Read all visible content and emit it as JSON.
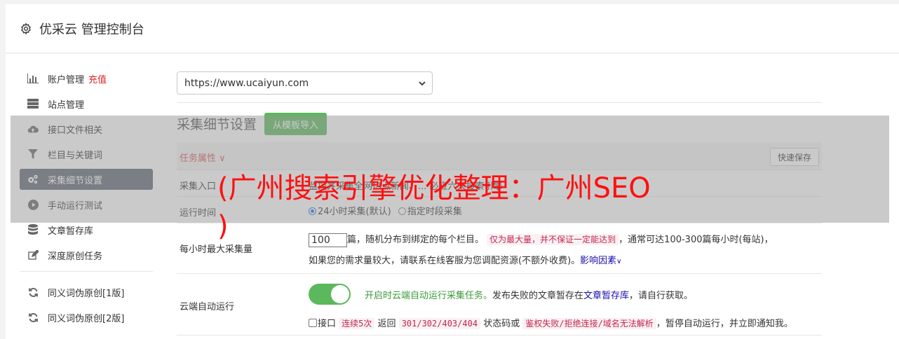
{
  "header": {
    "icon": "gear-icon",
    "title": "优采云 管理控制台"
  },
  "sidebar": {
    "items": [
      {
        "icon": "bar-chart-icon",
        "label": "账户管理",
        "extra": "充值"
      },
      {
        "icon": "server-icon",
        "label": "站点管理"
      },
      {
        "icon": "cloud-upload-icon",
        "label": "接口文件相关"
      },
      {
        "icon": "filter-icon",
        "label": "栏目与关键词"
      },
      {
        "icon": "cogs-icon",
        "label": "采集细节设置"
      },
      {
        "icon": "play-circle-icon",
        "label": "手动运行测试"
      },
      {
        "icon": "database-icon",
        "label": "文章暂存库"
      },
      {
        "icon": "edit-icon",
        "label": "深度原创任务"
      },
      {
        "icon": "refresh-icon",
        "label": "同义词伪原创[1版]"
      },
      {
        "icon": "refresh-icon",
        "label": "同义词伪原创[2版]"
      }
    ]
  },
  "site_select": {
    "value": "https://www.ucaiyun.com"
  },
  "section": {
    "title": "采集细节设置",
    "import_button": "从模板导入"
  },
  "table": {
    "task_attr": "任务属性",
    "quick_save": "快速保存",
    "entry": {
      "label": "采集入口",
      "value": "监控并采集全网热点新闻、... 必应六大搜索引擎"
    },
    "runtime": {
      "label": "运行时间",
      "opt1": "24小时采集(默认)",
      "opt2": "指定时段采集"
    },
    "per_hour": {
      "label": "每小时最大采集量",
      "input_value": "100",
      "t1": "篇，随机分布到绑定的每个栏目。",
      "code": "仅为最大量，并不保证一定能达到",
      "t2": "，通常可达100-300篇每小时(每站)，",
      "t3": "如果您的需求量较大，请联系在线客服为您调配资源(不额外收费)。",
      "link": "影响因素"
    },
    "cloud": {
      "label": "云端自动运行",
      "desc1": "开启时云端自动运行采集任务。",
      "desc2": "发布失败的文章暂存在",
      "desc_link": "文章暂存库",
      "desc3": "，请自行获取。",
      "cb_label": "接口",
      "code1": "连续5次",
      "t_return": "返回",
      "code2": "301/302/403/404",
      "t_status": "状态码或",
      "code3": "鉴权失败/拒绝连接/域名无法解析",
      "t_end": "，暂停自动运行，并立即通知我。"
    }
  },
  "watermark": {
    "line1": "(广州搜索引擎优化整理：广州SEO",
    "line2": ")"
  }
}
